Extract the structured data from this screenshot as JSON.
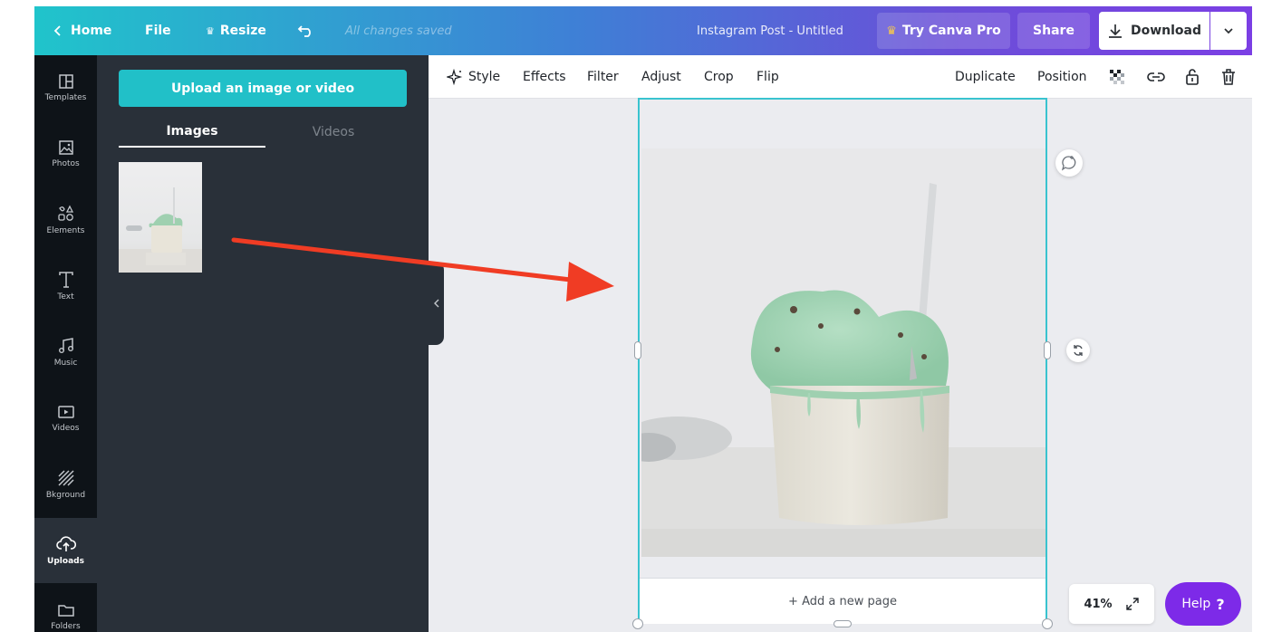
{
  "topbar": {
    "home_label": "Home",
    "file_label": "File",
    "resize_label": "Resize",
    "saved_status": "All changes saved",
    "doc_title": "Instagram Post - Untitled",
    "try_pro_label": "Try Canva Pro",
    "share_label": "Share",
    "download_label": "Download"
  },
  "rail": {
    "items": [
      {
        "label": "Templates",
        "icon": "templates-icon"
      },
      {
        "label": "Photos",
        "icon": "photos-icon"
      },
      {
        "label": "Elements",
        "icon": "elements-icon"
      },
      {
        "label": "Text",
        "icon": "text-icon"
      },
      {
        "label": "Music",
        "icon": "music-icon"
      },
      {
        "label": "Videos",
        "icon": "videos-icon"
      },
      {
        "label": "Bkground",
        "icon": "background-icon"
      },
      {
        "label": "Uploads",
        "icon": "uploads-icon"
      },
      {
        "label": "Folders",
        "icon": "folders-icon"
      }
    ],
    "active": "Uploads"
  },
  "panel": {
    "upload_button": "Upload an image or video",
    "tabs": [
      "Images",
      "Videos"
    ],
    "active_tab": "Images"
  },
  "toolbar": {
    "style": "Style",
    "effects": "Effects",
    "filter": "Filter",
    "adjust": "Adjust",
    "crop": "Crop",
    "flip": "Flip",
    "duplicate": "Duplicate",
    "position": "Position"
  },
  "canvas": {
    "add_page": "+ Add a new page"
  },
  "footer": {
    "zoom": "41%",
    "help_label": "Help",
    "help_mark": "?"
  },
  "colors": {
    "accent": "#21c0c8",
    "selection": "#39c3cf",
    "help": "#7d2ae8",
    "annotation_arrow": "#f03c24"
  }
}
